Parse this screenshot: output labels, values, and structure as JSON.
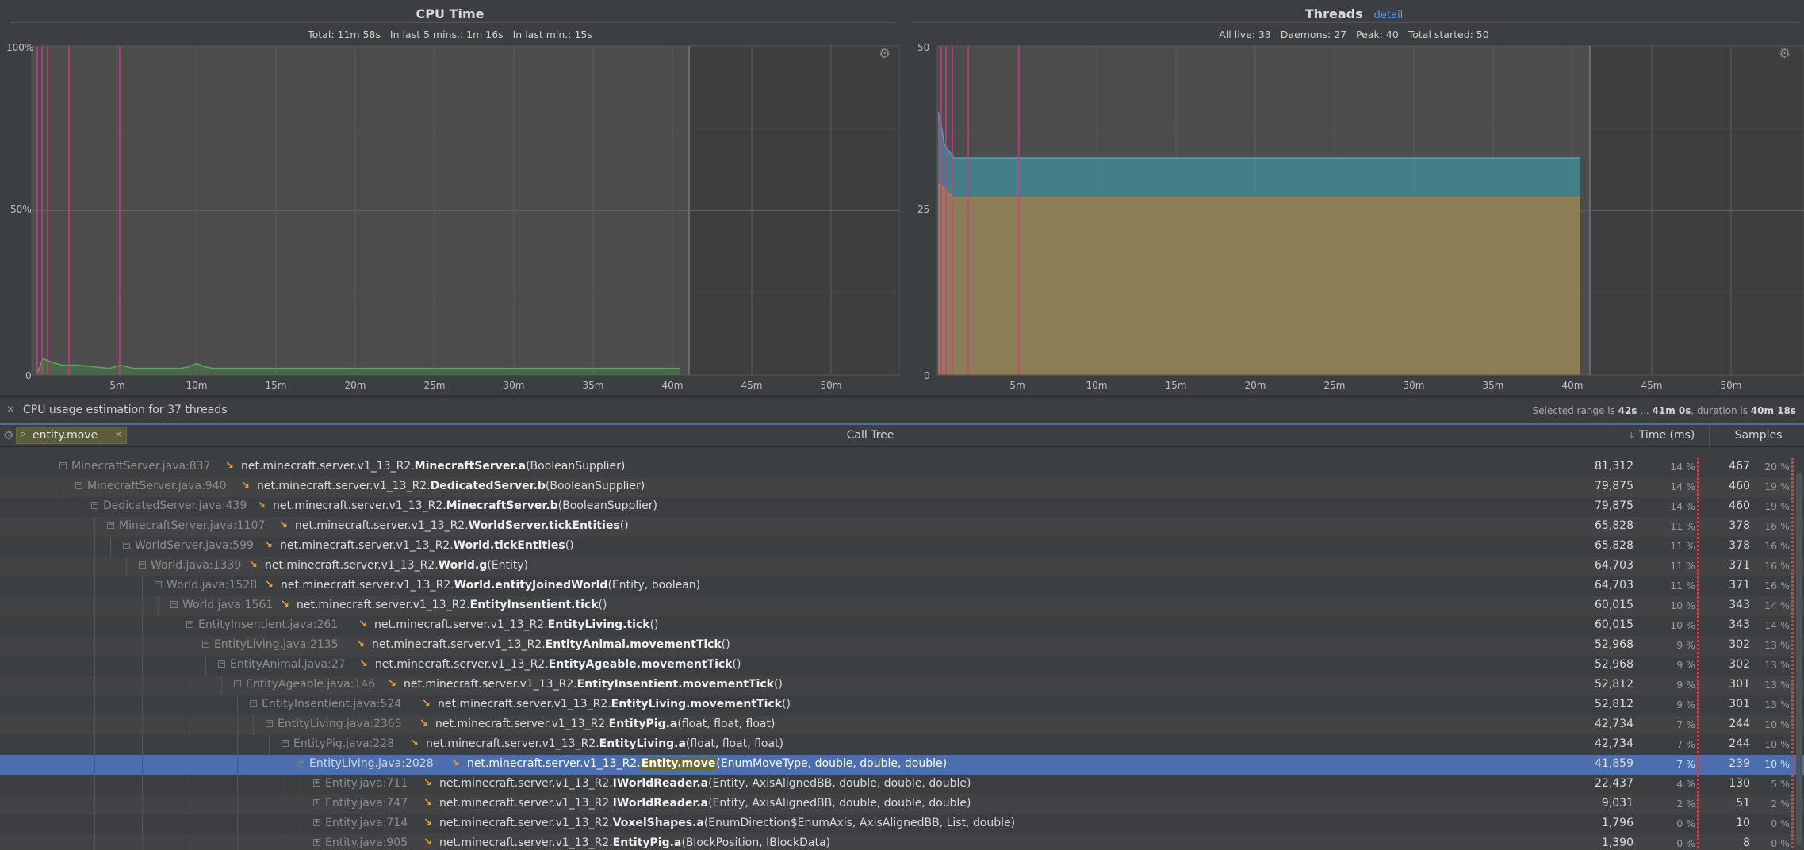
{
  "cpu": {
    "title": "CPU Time",
    "stats": "Total: 11m 58s   In last 5 mins.: 1m 16s   In last min.: 15s",
    "y_ticks": [
      "100%",
      "50%",
      "0"
    ],
    "x_ticks": [
      "5m",
      "10m",
      "15m",
      "20m",
      "25m",
      "30m",
      "35m",
      "40m",
      "45m",
      "50m"
    ]
  },
  "threads": {
    "title": "Threads",
    "detail_link": "detail",
    "stats": "All live: 33   Daemons: 27   Peak: 40   Total started: 50",
    "y_ticks": [
      "50",
      "25",
      "0"
    ],
    "x_ticks": [
      "5m",
      "10m",
      "15m",
      "20m",
      "25m",
      "30m",
      "35m",
      "40m",
      "45m",
      "50m"
    ]
  },
  "chart_data": [
    {
      "type": "area",
      "title": "CPU Time",
      "x_unit": "minutes",
      "ylim": [
        0,
        100
      ],
      "grid": true,
      "series": [
        {
          "color": "#4caf50",
          "x": [
            0,
            0.3,
            0.8,
            1.5,
            2.5,
            3.5,
            4.5,
            5.2,
            6,
            7,
            8,
            9,
            9.5,
            10,
            10.5,
            11,
            15,
            20,
            25,
            30,
            35,
            40.5
          ],
          "y": [
            1,
            5,
            4,
            3,
            3,
            2.5,
            2,
            3,
            2,
            2,
            2,
            2,
            2.5,
            3.5,
            2.5,
            2,
            2,
            2,
            2,
            2,
            2,
            2
          ]
        }
      ]
    },
    {
      "type": "area",
      "title": "Threads",
      "x_unit": "minutes",
      "ylim": [
        0,
        50
      ],
      "grid": true,
      "series": [
        {
          "color": "#3aa9b6",
          "x": [
            0,
            0.2,
            0.4,
            0.7,
            1.0,
            1.5,
            5,
            10,
            20,
            30,
            40.5
          ],
          "y": [
            40,
            38,
            35,
            34,
            33,
            33,
            33,
            33,
            33,
            33,
            33
          ]
        },
        {
          "color": "#c97c2e",
          "x": [
            0,
            0.3,
            0.7,
            1.0,
            1.5,
            5,
            10,
            20,
            30,
            40.5
          ],
          "y": [
            29,
            28.5,
            27.5,
            27,
            27,
            27,
            27,
            27,
            27,
            27
          ]
        }
      ]
    }
  ],
  "status": {
    "close": "×",
    "text": "CPU usage estimation for 37 threads",
    "range_prefix": "Selected range is ",
    "range_start": "42s",
    "range_mid": " ... ",
    "range_end": "41m 0s",
    "range_dur_prefix": ", duration is ",
    "range_dur": "40m 18s"
  },
  "tree_header": {
    "gear": "⚙",
    "search_icon": "⌕",
    "search_value": "entity.move",
    "search_clear": "×",
    "call_tree": "Call Tree",
    "time_col": "Time (ms)",
    "sort_arrow": "↓",
    "samples_col": "Samples"
  },
  "rows": [
    {
      "loc": "MinecraftServer.java:837",
      "pkg": "net.minecraft.server.v1_13_R2.",
      "bold": "MinecraftServer.a",
      "args": "(BooleanSupplier)",
      "time": "81,312",
      "time_pct": "14 %",
      "samples": "467",
      "samples_pct": "20 %"
    },
    {
      "loc": "MinecraftServer.java:940",
      "pkg": "net.minecraft.server.v1_13_R2.",
      "bold": "DedicatedServer.b",
      "args": "(BooleanSupplier)",
      "time": "79,875",
      "time_pct": "14 %",
      "samples": "460",
      "samples_pct": "19 %"
    },
    {
      "loc": "DedicatedServer.java:439",
      "pkg": "net.minecraft.server.v1_13_R2.",
      "bold": "MinecraftServer.b",
      "args": "(BooleanSupplier)",
      "time": "79,875",
      "time_pct": "14 %",
      "samples": "460",
      "samples_pct": "19 %"
    },
    {
      "loc": "MinecraftServer.java:1107",
      "pkg": "net.minecraft.server.v1_13_R2.",
      "bold": "WorldServer.tickEntities",
      "args": "()",
      "time": "65,828",
      "time_pct": "11 %",
      "samples": "378",
      "samples_pct": "16 %"
    },
    {
      "loc": "WorldServer.java:599",
      "pkg": "net.minecraft.server.v1_13_R2.",
      "bold": "World.tickEntities",
      "args": "()",
      "time": "65,828",
      "time_pct": "11 %",
      "samples": "378",
      "samples_pct": "16 %"
    },
    {
      "loc": "World.java:1339",
      "pkg": "net.minecraft.server.v1_13_R2.",
      "bold": "World.g",
      "args": "(Entity)",
      "time": "64,703",
      "time_pct": "11 %",
      "samples": "371",
      "samples_pct": "16 %"
    },
    {
      "loc": "World.java:1528",
      "pkg": "net.minecraft.server.v1_13_R2.",
      "bold": "World.entityJoinedWorld",
      "args": "(Entity, boolean)",
      "time": "64,703",
      "time_pct": "11 %",
      "samples": "371",
      "samples_pct": "16 %"
    },
    {
      "loc": "World.java:1561",
      "pkg": "net.minecraft.server.v1_13_R2.",
      "bold": "EntityInsentient.tick",
      "args": "()",
      "time": "60,015",
      "time_pct": "10 %",
      "samples": "343",
      "samples_pct": "14 %"
    },
    {
      "loc": "EntityInsentient.java:261",
      "pkg": "net.minecraft.server.v1_13_R2.",
      "bold": "EntityLiving.tick",
      "args": "()",
      "time": "60,015",
      "time_pct": "10 %",
      "samples": "343",
      "samples_pct": "14 %"
    },
    {
      "loc": "EntityLiving.java:2135",
      "pkg": "net.minecraft.server.v1_13_R2.",
      "bold": "EntityAnimal.movementTick",
      "args": "()",
      "time": "52,968",
      "time_pct": "9 %",
      "samples": "302",
      "samples_pct": "13 %"
    },
    {
      "loc": "EntityAnimal.java:27",
      "pkg": "net.minecraft.server.v1_13_R2.",
      "bold": "EntityAgeable.movementTick",
      "args": "()",
      "time": "52,968",
      "time_pct": "9 %",
      "samples": "302",
      "samples_pct": "13 %"
    },
    {
      "loc": "EntityAgeable.java:146",
      "pkg": "net.minecraft.server.v1_13_R2.",
      "bold": "EntityInsentient.movementTick",
      "args": "()",
      "time": "52,812",
      "time_pct": "9 %",
      "samples": "301",
      "samples_pct": "13 %"
    },
    {
      "loc": "EntityInsentient.java:524",
      "pkg": "net.minecraft.server.v1_13_R2.",
      "bold": "EntityLiving.movementTick",
      "args": "()",
      "time": "52,812",
      "time_pct": "9 %",
      "samples": "301",
      "samples_pct": "13 %"
    },
    {
      "loc": "EntityLiving.java:2365",
      "pkg": "net.minecraft.server.v1_13_R2.",
      "bold": "EntityPig.a",
      "args": "(float, float, float)",
      "time": "42,734",
      "time_pct": "7 %",
      "samples": "244",
      "samples_pct": "10 %"
    },
    {
      "loc": "EntityPig.java:228",
      "pkg": "net.minecraft.server.v1_13_R2.",
      "bold": "EntityLiving.a",
      "args": "(float, float, float)",
      "time": "42,734",
      "time_pct": "7 %",
      "samples": "244",
      "samples_pct": "10 %"
    },
    {
      "loc": "EntityLiving.java:2028",
      "pkg": "net.minecraft.server.v1_13_R2.",
      "bold": "Entity.move",
      "args": "(EnumMoveType, double, double, double)",
      "time": "41,859",
      "time_pct": "7 %",
      "samples": "239",
      "samples_pct": "10 %",
      "selected": true
    },
    {
      "loc": "Entity.java:711",
      "pkg": "net.minecraft.server.v1_13_R2.",
      "bold": "IWorldReader.a",
      "args": "(Entity, AxisAlignedBB, double, double, double)",
      "time": "22,437",
      "time_pct": "4 %",
      "samples": "130",
      "samples_pct": "5 %"
    },
    {
      "loc": "Entity.java:747",
      "pkg": "net.minecraft.server.v1_13_R2.",
      "bold": "IWorldReader.a",
      "args": "(Entity, AxisAlignedBB, double, double, double)",
      "time": "9,031",
      "time_pct": "2 %",
      "samples": "51",
      "samples_pct": "2 %"
    },
    {
      "loc": "Entity.java:714",
      "pkg": "net.minecraft.server.v1_13_R2.",
      "bold": "VoxelShapes.a",
      "args": "(EnumDirection$EnumAxis, AxisAlignedBB, List, double)",
      "time": "1,796",
      "time_pct": "0 %",
      "samples": "10",
      "samples_pct": "0 %"
    },
    {
      "loc": "Entity.java:905",
      "pkg": "net.minecraft.server.v1_13_R2.",
      "bold": "EntityPig.a",
      "args": "(BlockPosition, IBlockData)",
      "time": "1,390",
      "time_pct": "0 %",
      "samples": "8",
      "samples_pct": "0 %"
    }
  ]
}
